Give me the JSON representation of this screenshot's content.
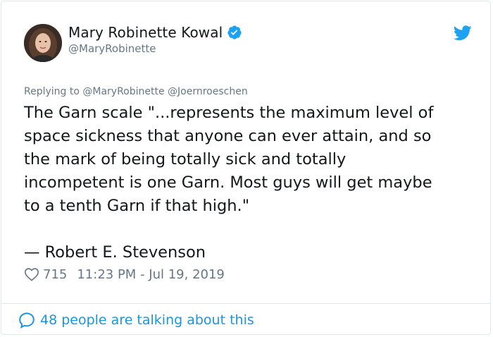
{
  "author": {
    "display_name": "Mary Robinette Kowal",
    "handle": "@MaryRobinette",
    "verified": true
  },
  "reply_to": "Replying to @MaryRobinette @Joernroeschen",
  "tweet": {
    "text": "The Garn scale \"...represents the maximum level of\nspace sickness that anyone can ever attain, and so\nthe mark of being totally sick and totally\nincompetent is one Garn. Most guys will get maybe\nto a tenth Garn if that high.\"\n\n— Robert E. Stevenson"
  },
  "meta": {
    "likes": "715",
    "timestamp": "11:23 PM - Jul 19, 2019"
  },
  "footer": {
    "talking_label": "48 people are talking about this"
  },
  "colors": {
    "twitter_blue": "#1da1f2",
    "link_blue": "#1b95e0",
    "secondary_text": "#657786",
    "primary_text": "#14171a"
  },
  "icons": [
    "verified-badge-icon",
    "twitter-bird-icon",
    "heart-icon",
    "speech-bubble-icon"
  ]
}
